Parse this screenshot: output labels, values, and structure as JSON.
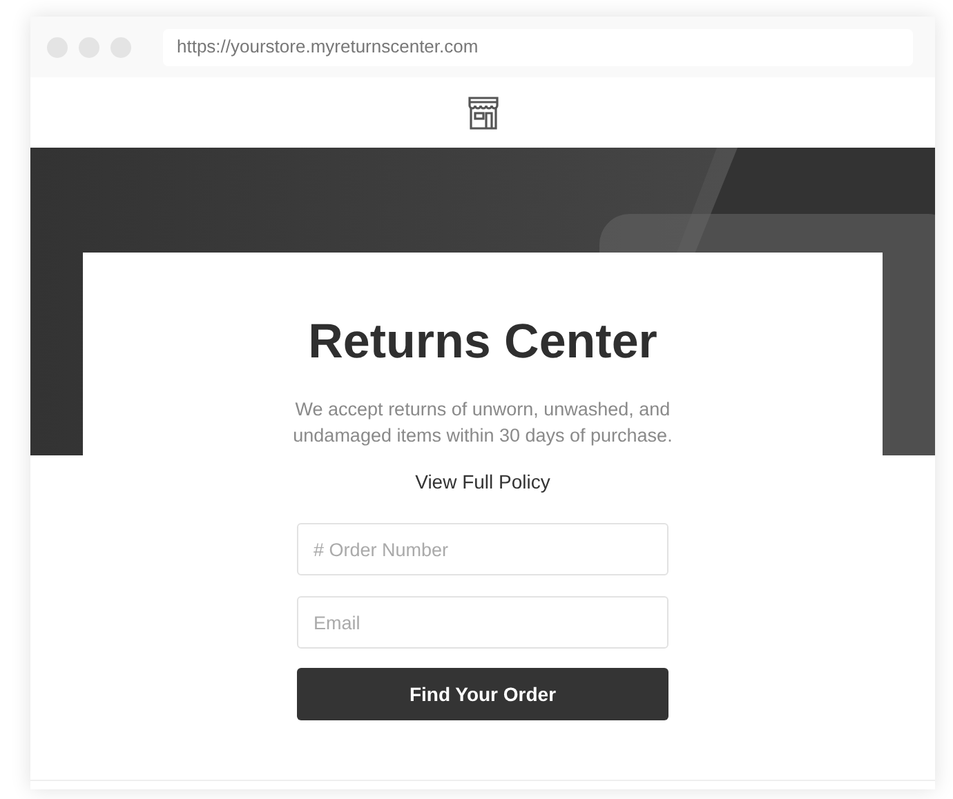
{
  "browser": {
    "url": "https://yourstore.myreturnscenter.com"
  },
  "page": {
    "title": "Returns Center",
    "description": "We accept returns of unworn, unwashed, and undamaged items within 30 days of purchase.",
    "policy_link": "View Full Policy",
    "fields": [
      {
        "placeholder": "# Order Number"
      },
      {
        "placeholder": "Email"
      }
    ],
    "button": "Find Your Order"
  }
}
